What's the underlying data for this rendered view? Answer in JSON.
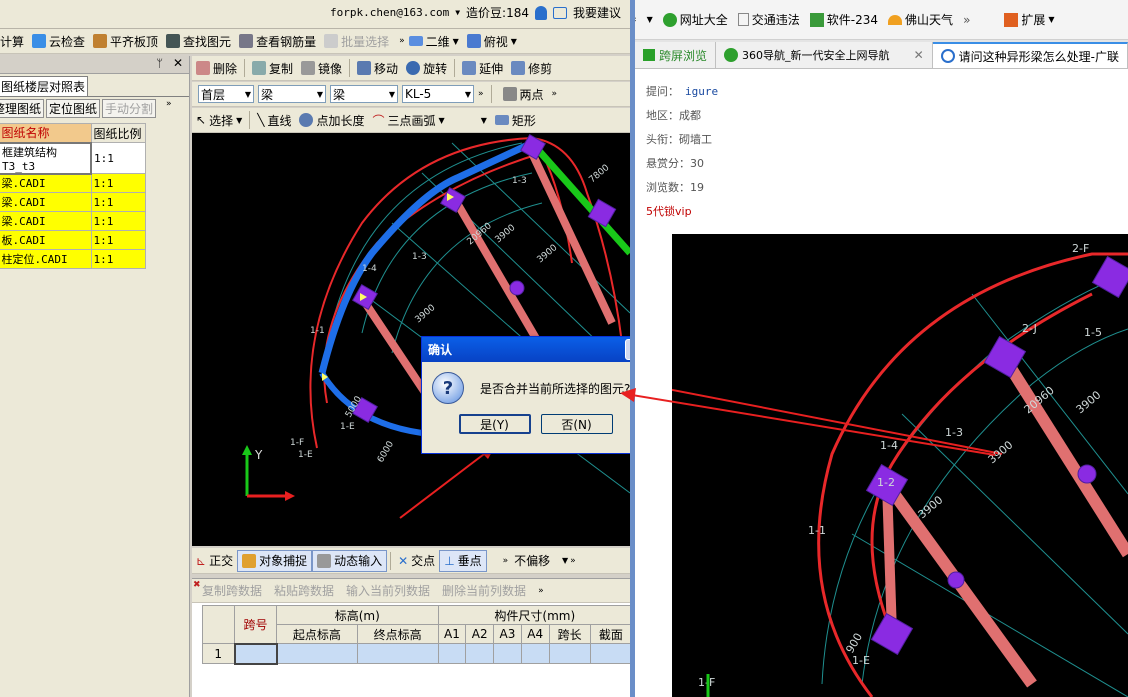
{
  "top": {
    "menu_left": "计算",
    "user": "forpk.chen@163.com",
    "beans": "造价豆:184",
    "suggest": "我要建议"
  },
  "toolbar1": {
    "cloud_check": "云检查",
    "level_top": "平齐板顶",
    "find": "查找图元",
    "view_rebar": "查看钢筋量",
    "batch": "批量选择",
    "view2d": "二维",
    "view_top": "俯视"
  },
  "panel": {
    "title": "图纸楼层对照表",
    "tab1": "整理图纸",
    "tab2": "定位图纸",
    "tab3": "手动分割",
    "col_name": "图纸名称",
    "col_ratio": "图纸比例",
    "rows": [
      {
        "name": "框建筑结构T3_t3",
        "ratio": "1:1"
      },
      {
        "name": "梁.CADI",
        "ratio": "1:1"
      },
      {
        "name": "梁.CADI",
        "ratio": "1:1"
      },
      {
        "name": "梁.CADI",
        "ratio": "1:1"
      },
      {
        "name": "板.CADI",
        "ratio": "1:1"
      },
      {
        "name": "柱定位.CADI",
        "ratio": "1:1"
      }
    ]
  },
  "edit": {
    "delete": "删除",
    "copy": "复制",
    "mirror": "镜像",
    "move": "移动",
    "rotate": "旋转",
    "extend": "延伸",
    "trim": "修剪"
  },
  "filters": {
    "floor": "首层",
    "type1": "梁",
    "type2": "梁",
    "member": "KL-5",
    "two_point": "两点"
  },
  "draw": {
    "select": "选择",
    "line": "直线",
    "point_len": "点加长度",
    "arc": "三点画弧",
    "rect": "矩形"
  },
  "snap": {
    "ortho": "正交",
    "obj_snap": "对象捕捉",
    "dyn_input": "动态输入",
    "intersect": "交点",
    "perp": "垂点",
    "offset": "不偏移"
  },
  "span": {
    "copy": "复制跨数据",
    "paste": "粘贴跨数据",
    "input_col": "输入当前列数据",
    "del_col": "删除当前列数据",
    "h_span": "跨号",
    "h_elev": "标高(m)",
    "h_dim": "构件尺寸(mm)",
    "h_start": "起点标高",
    "h_end": "终点标高",
    "a1": "A1",
    "a2": "A2",
    "a3": "A3",
    "a4": "A4",
    "span_len": "跨长",
    "section": "截面",
    "row1": "1"
  },
  "dialog": {
    "title": "确认",
    "message": "是否合并当前所选择的图元?",
    "yes": "是(Y)",
    "no": "否(N)"
  },
  "cad": {
    "l14": "1-4",
    "l13": "1-3",
    "l1f": "1-F",
    "l1e": "1-E",
    "l11": "1-1",
    "d3900": "3900",
    "d7800": "7800",
    "d6000": "6000",
    "d20960": "20960",
    "d5000": "5000",
    "axis_y": "Y"
  },
  "browser": {
    "nav1": "网址大全",
    "nav2": "交通违法",
    "nav3": "软件-234",
    "nav4": "佛山天气",
    "ext": "扩展",
    "tab1": "跨屏浏览",
    "tab2": "360导航_新一代安全上网导航",
    "tab3": "请问这种异形梁怎么处理-广联",
    "q_asker_l": "提问：",
    "q_asker": "igure",
    "q_region_l": "地区：",
    "q_region": "成都",
    "q_title_l": "头衔：",
    "q_title": "砌墙工",
    "q_reward_l": "悬赏分：",
    "q_reward": "30",
    "q_views_l": "浏览数：",
    "q_views": "19",
    "vip": "5代锁vip",
    "z_l2f": "2-F",
    "z_l2j": "2-J",
    "z_l15": "1-5",
    "z_l14": "1-4",
    "z_l13": "1-3",
    "z_l12": "1-2",
    "z_l11": "1-1",
    "z_l1f": "1-F",
    "z_l1e": "1-E",
    "z_d3900": "3900",
    "z_d20960": "20960",
    "z_d900": "900"
  }
}
